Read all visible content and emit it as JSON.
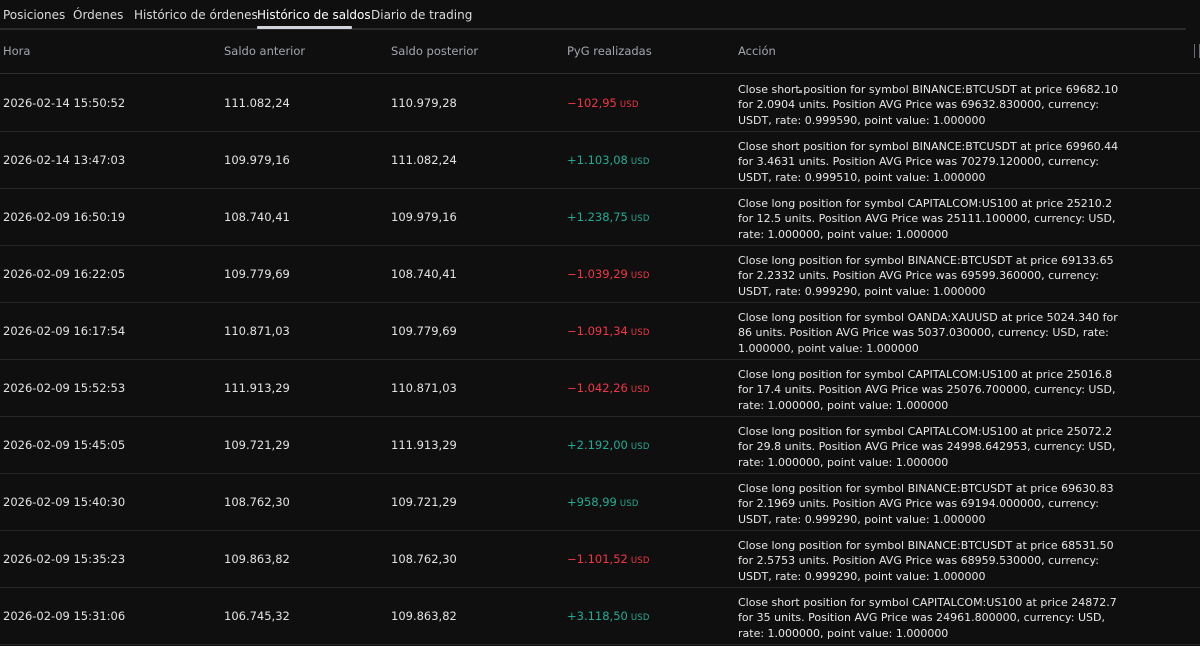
{
  "tabs": [
    {
      "label": "Posiciones",
      "active": false
    },
    {
      "label": "Órdenes",
      "active": false
    },
    {
      "label": "Histórico de órdenes",
      "active": false
    },
    {
      "label": "Histórico de saldos",
      "active": true
    },
    {
      "label": "Diario de trading",
      "active": false
    }
  ],
  "table": {
    "columns": {
      "time": "Hora",
      "prev_balance": "Saldo anterior",
      "next_balance": "Saldo posterior",
      "realized_pnl": "PyG realizadas",
      "action": "Acción"
    },
    "rows": [
      {
        "time": "2026-02-14 15:50:52",
        "prev": "111.082,24",
        "next": "110.979,28",
        "pnl": "−102,95",
        "currency": "USD",
        "direction": "negative",
        "action": "Close short position for symbol BINANCE:BTCUSDT at price 69682.10 for 2.0904 units. Position AVG Price was 69632.830000, currency: USDT, rate: 0.999590, point value: 1.000000"
      },
      {
        "time": "2026-02-14 13:47:03",
        "prev": "109.979,16",
        "next": "111.082,24",
        "pnl": "+1.103,08",
        "currency": "USD",
        "direction": "positive",
        "action": "Close short position for symbol BINANCE:BTCUSDT at price 69960.44 for 3.4631 units. Position AVG Price was 70279.120000, currency: USDT, rate: 0.999510, point value: 1.000000"
      },
      {
        "time": "2026-02-09 16:50:19",
        "prev": "108.740,41",
        "next": "109.979,16",
        "pnl": "+1.238,75",
        "currency": "USD",
        "direction": "positive",
        "action": "Close long position for symbol CAPITALCOM:US100 at price 25210.2 for 12.5 units. Position AVG Price was 25111.100000, currency: USD, rate: 1.000000, point value: 1.000000"
      },
      {
        "time": "2026-02-09 16:22:05",
        "prev": "109.779,69",
        "next": "108.740,41",
        "pnl": "−1.039,29",
        "currency": "USD",
        "direction": "negative",
        "action": "Close long position for symbol BINANCE:BTCUSDT at price 69133.65 for 2.2332 units. Position AVG Price was 69599.360000, currency: USDT, rate: 0.999290, point value: 1.000000"
      },
      {
        "time": "2026-02-09 16:17:54",
        "prev": "110.871,03",
        "next": "109.779,69",
        "pnl": "−1.091,34",
        "currency": "USD",
        "direction": "negative",
        "action": "Close long position for symbol OANDA:XAUUSD at price 5024.340 for 86 units. Position AVG Price was 5037.030000, currency: USD, rate: 1.000000, point value: 1.000000"
      },
      {
        "time": "2026-02-09 15:52:53",
        "prev": "111.913,29",
        "next": "110.871,03",
        "pnl": "−1.042,26",
        "currency": "USD",
        "direction": "negative",
        "action": "Close long position for symbol CAPITALCOM:US100 at price 25016.8 for 17.4 units. Position AVG Price was 25076.700000, currency: USD, rate: 1.000000, point value: 1.000000"
      },
      {
        "time": "2026-02-09 15:45:05",
        "prev": "109.721,29",
        "next": "111.913,29",
        "pnl": "+2.192,00",
        "currency": "USD",
        "direction": "positive",
        "action": "Close long position for symbol CAPITALCOM:US100 at price 25072.2 for 29.8 units. Position AVG Price was 24998.642953, currency: USD, rate: 1.000000, point value: 1.000000"
      },
      {
        "time": "2026-02-09 15:40:30",
        "prev": "108.762,30",
        "next": "109.721,29",
        "pnl": "+958,99",
        "currency": "USD",
        "direction": "positive",
        "action": "Close long position for symbol BINANCE:BTCUSDT at price 69630.83 for 2.1969 units. Position AVG Price was 69194.000000, currency: USDT, rate: 0.999290, point value: 1.000000"
      },
      {
        "time": "2026-02-09 15:35:23",
        "prev": "109.863,82",
        "next": "108.762,30",
        "pnl": "−1.101,52",
        "currency": "USD",
        "direction": "negative",
        "action": "Close long position for symbol BINANCE:BTCUSDT at price 68531.50 for 2.5753 units. Position AVG Price was 68959.530000, currency: USDT, rate: 0.999290, point value: 1.000000"
      },
      {
        "time": "2026-02-09 15:31:06",
        "prev": "106.745,32",
        "next": "109.863,82",
        "pnl": "+3.118,50",
        "currency": "USD",
        "direction": "positive",
        "action": "Close short position for symbol CAPITALCOM:US100 at price 24872.7 for 35 units. Position AVG Price was 24961.800000, currency: USD, rate: 1.000000, point value: 1.000000"
      }
    ]
  },
  "colors": {
    "background": "#0f0f0f",
    "negative": "#f23645",
    "positive": "#22ab94",
    "text": "#dbdbdb"
  }
}
